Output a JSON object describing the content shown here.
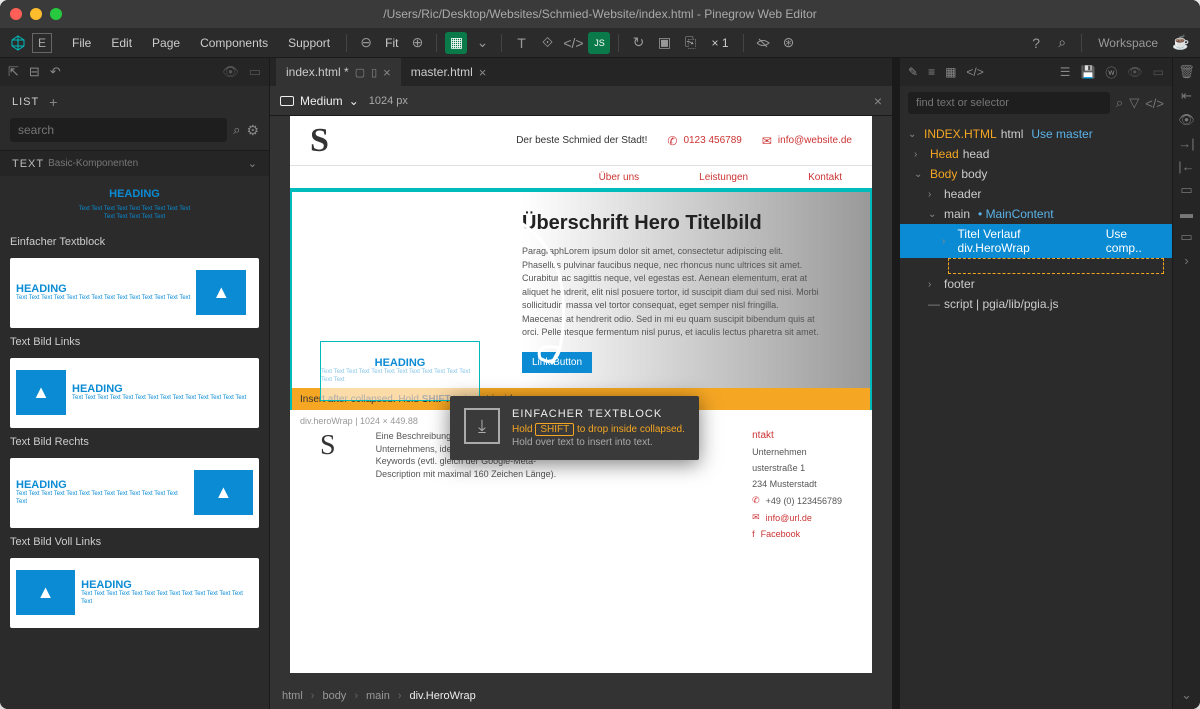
{
  "title": "/Users/Ric/Desktop/Websites/Schmied-Website/index.html - Pinegrow Web Editor",
  "menu": [
    "File",
    "Edit",
    "Page",
    "Components",
    "Support"
  ],
  "toolbar": {
    "fit": "Fit",
    "mult": "× 1",
    "workspace": "Workspace"
  },
  "left": {
    "list_label": "LIST",
    "search_placeholder": "search",
    "category": "TEXT",
    "category_sub": "Basic-Komponenten",
    "comp_heading": "HEADING",
    "comp_lorem": "Text Text Text Text Text Text Text Text Text Text Text Text Text Text",
    "labels": [
      "Einfacher Textblock",
      "Text Bild Links",
      "Text Bild Rechts",
      "Text Bild Voll Links"
    ]
  },
  "tabs": [
    {
      "name": "index.html *",
      "active": true
    },
    {
      "name": "master.html",
      "active": false
    }
  ],
  "viewport": {
    "size": "Medium",
    "px": "1024 px"
  },
  "dropbar": {
    "pre": "Insert after collapsed. Hold",
    "key": "SHIFT",
    "post": "to insert inside",
    "dim": "div.heroWrap | 1024 × 449.88"
  },
  "site": {
    "tagline": "Der beste Schmied der Stadt!",
    "phone": "0123 456789",
    "email": "info@website.de",
    "nav": [
      "Über uns",
      "Leistungen",
      "Kontakt"
    ],
    "hero_title": "Überschrift Hero Titelbild",
    "hero_para": "ParagraphLorem ipsum dolor sit amet, consectetur adipiscing elit. Phasellus pulvinar faucibus neque, nec rhoncus nunc ultrices sit amet. Curabitur ac sagittis neque, vel egestas est. Aenean elementum, erat at aliquet hendrerit, elit nisl posuere tortor, id suscipit diam dui sed nisi. Morbi sollicitudin massa vel tortor consequat, eget semper nisl fringilla. Maecenas at hendrerit odio. Sed in mi eu quam suscipit bibendum quis at orci. Pellentesque fermentum nisl purus, et iaculis lectus pharetra sit amet.",
    "hero_btn": "Link Button",
    "footer_desc": "Eine Beschreibung der Seite / des Unternehmens, idealerweise mit wichtigen Keywords (evtl. gleich der Google-Meta-Description mit maximal 160 Zeichen Länge).",
    "f_contact": "ntakt",
    "f_company": "Unternehmen",
    "f_street": "usterstraße 1",
    "f_city": "234 Musterstadt",
    "f_phone": "+49 (0) 123456789",
    "f_email": "info@url.de",
    "f_fb": "Facebook"
  },
  "tip": {
    "title": "EINFACHER TEXTBLOCK",
    "line1a": "Hold",
    "key": "SHIFT",
    "line1b": "to drop inside collapsed.",
    "line2": "Hold over text to insert into text."
  },
  "bc": [
    "html",
    "body",
    "main",
    "div.HeroWrap"
  ],
  "right": {
    "search_placeholder": "find text or selector",
    "root": "INDEX.HTML",
    "root_el": "html",
    "root_link": "Use master",
    "head": "Head",
    "head_el": "head",
    "body": "Body",
    "body_el": "body",
    "header": "header",
    "main": "main",
    "main_link": "MainContent",
    "sel": "Titel Verlauf div.HeroWrap",
    "sel_link": "Use comp..",
    "footer": "footer",
    "script": "script | pgia/lib/pgia.js"
  }
}
